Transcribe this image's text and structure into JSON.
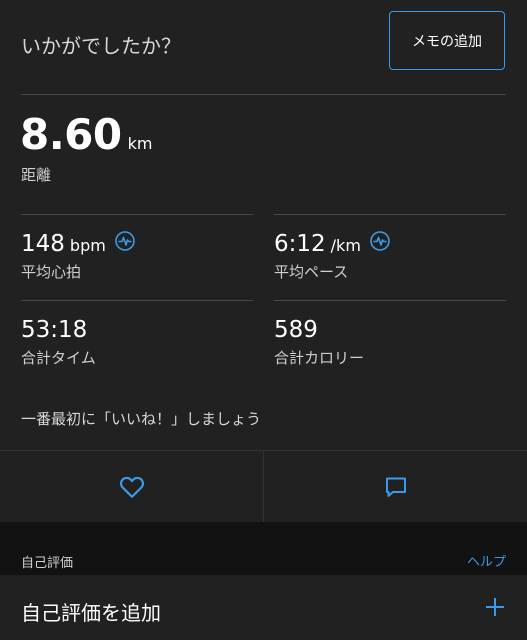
{
  "header": {
    "question": "いかがでしたか？",
    "memo_button": "メモの追加"
  },
  "distance": {
    "value": "8.60",
    "unit": "km",
    "label": "距離"
  },
  "stats": {
    "heart_rate": {
      "value": "148",
      "unit": "bpm",
      "label": "平均心拍",
      "icon": "pulse-icon"
    },
    "pace": {
      "value": "6:12",
      "unit": "/km",
      "label": "平均ペース",
      "icon": "pulse-icon"
    },
    "time": {
      "value": "53:18",
      "label": "合計タイム"
    },
    "calories": {
      "value": "589",
      "label": "合計カロリー"
    }
  },
  "kudos": {
    "text": "一番最初に「いいね！」しましょう"
  },
  "actions": {
    "like_icon": "heart-icon",
    "comment_icon": "comment-icon"
  },
  "self_evaluation": {
    "title": "自己評価",
    "help": "ヘルプ",
    "add_label": "自己評価を追加",
    "add_icon": "plus-icon"
  },
  "colors": {
    "background": "#212121",
    "accent": "#3d9ae8",
    "section_background": "#121212"
  }
}
